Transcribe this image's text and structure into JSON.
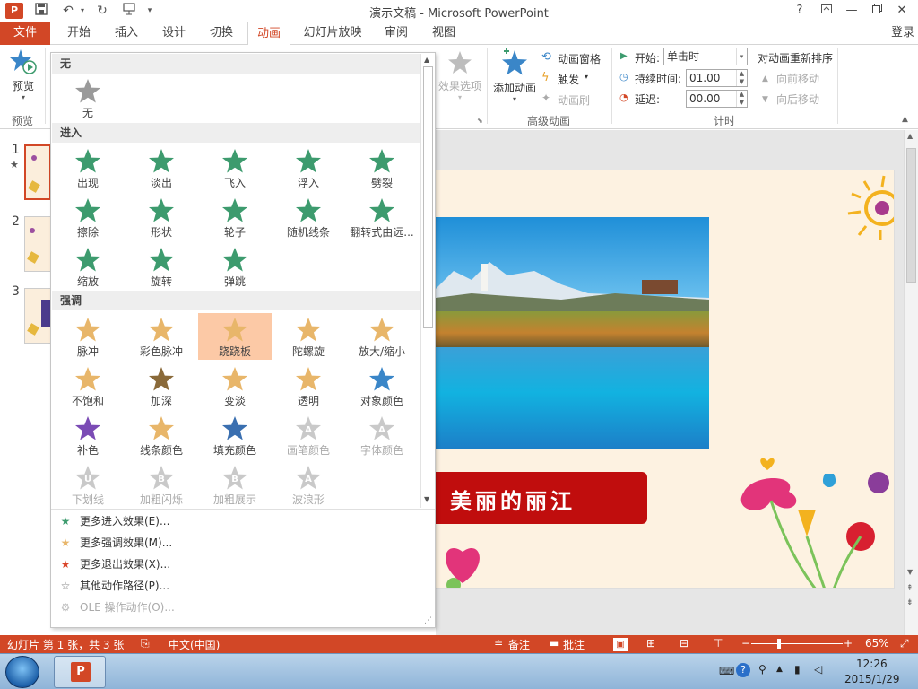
{
  "window": {
    "title": "演示文稿 - Microsoft PowerPoint",
    "app_logo": "P",
    "help": "?",
    "controls": [
      "ribbon-options",
      "minimize",
      "restore",
      "close"
    ]
  },
  "tabs": {
    "file": "文件",
    "items": [
      "开始",
      "插入",
      "设计",
      "切换",
      "动画",
      "幻灯片放映",
      "审阅",
      "视图"
    ],
    "active": "动画",
    "login": "登录"
  },
  "ribbon": {
    "preview": {
      "label": "预览",
      "group": "预览"
    },
    "effect_options": "效果选项",
    "add_animation": "添加动画",
    "animation_pane": "动画窗格",
    "trigger": "触发",
    "animation_painter": "动画刷",
    "advanced_group": "高级动画",
    "start_label": "开始:",
    "start_value": "单击时",
    "duration_label": "持续时间:",
    "duration_value": "01.00",
    "delay_label": "延迟:",
    "delay_value": "00.00",
    "timing_group": "计时",
    "reorder_title": "对动画重新排序",
    "move_earlier": "向前移动",
    "move_later": "向后移动"
  },
  "slides_panel": {
    "numbers": [
      "1",
      "2",
      "3"
    ],
    "star_marker": "★"
  },
  "gallery": {
    "sections": {
      "none": "无",
      "entrance": "进入",
      "emphasis": "强调"
    },
    "none_items": [
      "无"
    ],
    "entrance_items": [
      "出现",
      "淡出",
      "飞入",
      "浮入",
      "劈裂",
      "擦除",
      "形状",
      "轮子",
      "随机线条",
      "翻转式由远...",
      "缩放",
      "旋转",
      "弹跳"
    ],
    "emphasis_items": [
      "脉冲",
      "彩色脉冲",
      "跷跷板",
      "陀螺旋",
      "放大/缩小",
      "不饱和",
      "加深",
      "变淡",
      "透明",
      "对象颜色",
      "补色",
      "线条颜色",
      "填充颜色",
      "画笔颜色",
      "字体颜色",
      "下划线",
      "加粗闪烁",
      "加粗展示",
      "波浪形"
    ],
    "highlighted": "跷跷板",
    "more": [
      "更多进入效果(E)...",
      "更多强调效果(M)...",
      "更多退出效果(X)...",
      "其他动作路径(P)...",
      "OLE 操作动作(O)..."
    ]
  },
  "slide": {
    "banner_text": "美丽的丽江"
  },
  "statusbar": {
    "slide_info": "幻灯片 第 1 张，共 3 张",
    "language": "中文(中国)",
    "notes": "备注",
    "comments": "批注",
    "zoom": "65%",
    "zoom_minus": "−",
    "zoom_plus": "+"
  },
  "taskbar": {
    "time": "12:26",
    "date": "2015/1/29"
  },
  "colors": {
    "accent": "#d24726",
    "entrance_star": "#3d9b6e",
    "emphasis_star": "#e8b66a",
    "exit_star": "#d9452a",
    "highlight": "#fcc9a6",
    "banner": "#c00d0d"
  }
}
